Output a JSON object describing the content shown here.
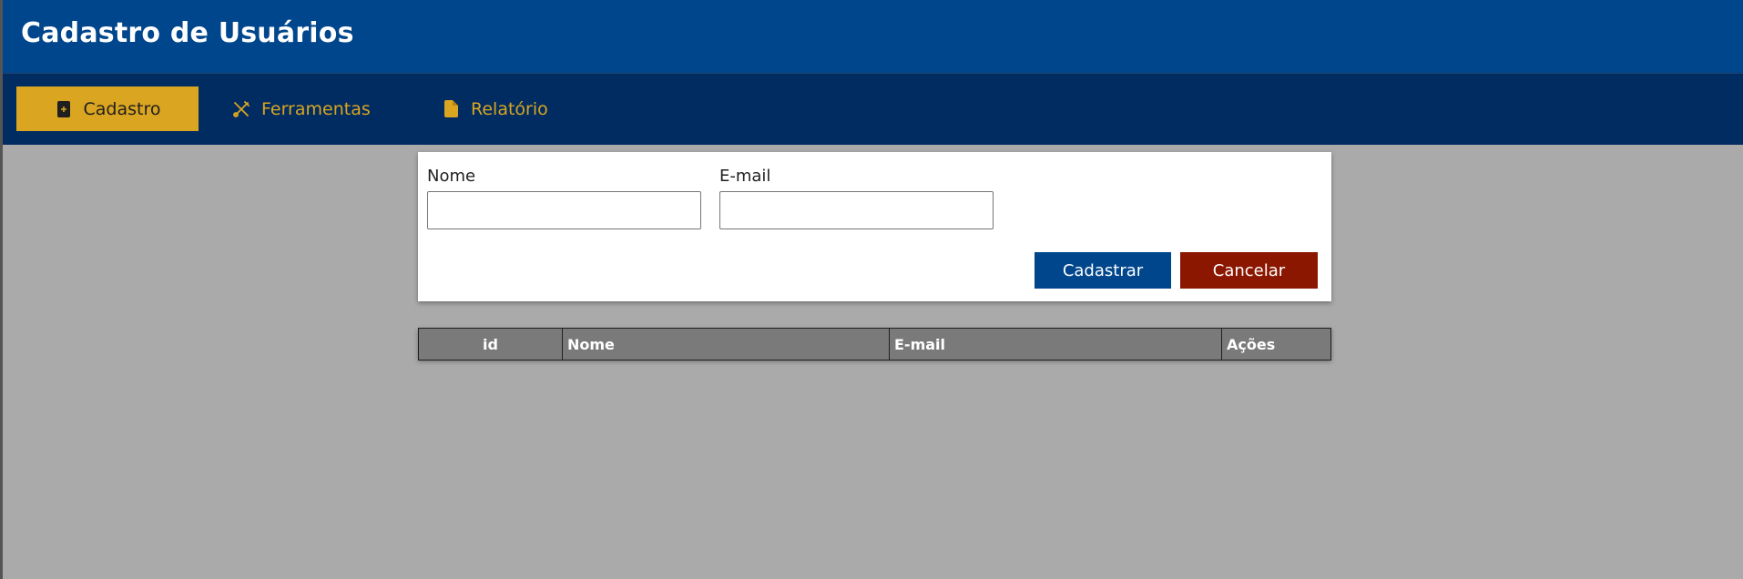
{
  "header": {
    "title": "Cadastro de Usuários"
  },
  "nav": {
    "items": [
      {
        "label": "Cadastro",
        "icon": "file-plus-icon",
        "active": true
      },
      {
        "label": "Ferramentas",
        "icon": "tools-icon",
        "active": false
      },
      {
        "label": "Relatório",
        "icon": "file-icon",
        "active": false
      }
    ]
  },
  "form": {
    "nome_label": "Nome",
    "nome_value": "",
    "email_label": "E-mail",
    "email_value": "",
    "submit_label": "Cadastrar",
    "cancel_label": "Cancelar"
  },
  "table": {
    "columns": [
      "id",
      "Nome",
      "E-mail",
      "Ações"
    ],
    "rows": []
  },
  "colors": {
    "header_bg": "#00468c",
    "nav_bg": "#002c62",
    "accent": "#daa520",
    "danger": "#8b1700",
    "page_bg": "#aaaaaa",
    "table_header_bg": "#7a7a7a"
  }
}
